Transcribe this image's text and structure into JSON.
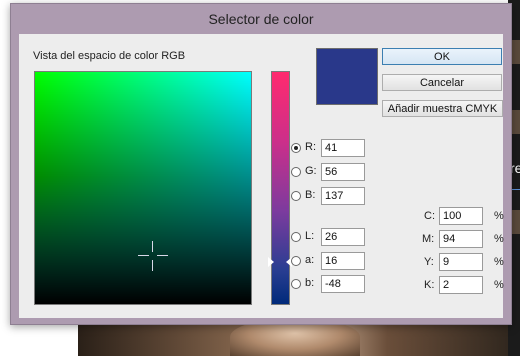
{
  "dialog": {
    "title": "Selector de color",
    "color_space_label": "Vista del espacio de color RGB",
    "current_color": "#29388a"
  },
  "buttons": {
    "ok": "OK",
    "cancel": "Cancelar",
    "add_cmyk": "Añadir muestra CMYK"
  },
  "rgb": [
    {
      "label": "R:",
      "value": "41",
      "selected": true
    },
    {
      "label": "G:",
      "value": "56",
      "selected": false
    },
    {
      "label": "B:",
      "value": "137",
      "selected": false
    }
  ],
  "lab": [
    {
      "label": "L:",
      "value": "26",
      "selected": false
    },
    {
      "label": "a:",
      "value": "16",
      "selected": false
    },
    {
      "label": "b:",
      "value": "-48",
      "selected": false
    }
  ],
  "cmyk": [
    {
      "label": "C:",
      "value": "100",
      "unit": "%"
    },
    {
      "label": "M:",
      "value": "94",
      "unit": "%"
    },
    {
      "label": "Y:",
      "value": "9",
      "unit": "%"
    },
    {
      "label": "K:",
      "value": "2",
      "unit": "%"
    }
  ],
  "background": {
    "right_text": "re"
  }
}
